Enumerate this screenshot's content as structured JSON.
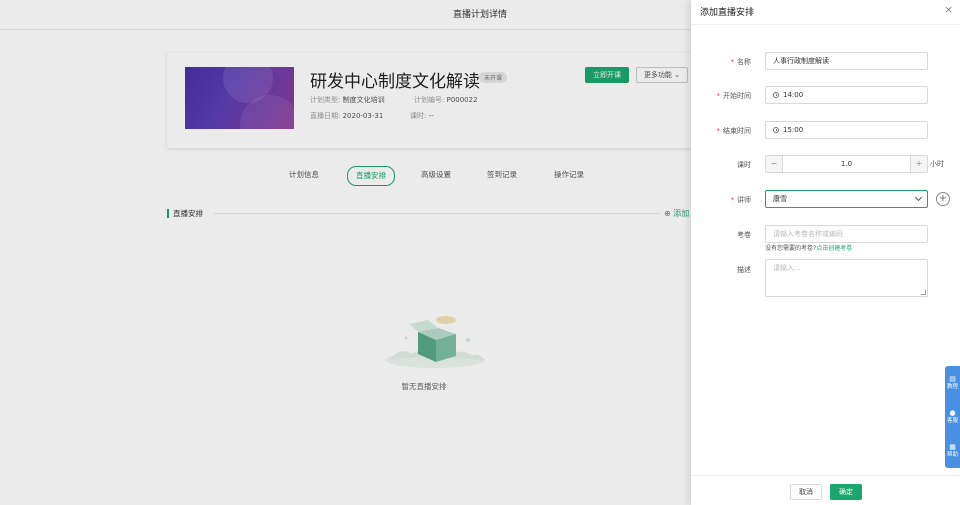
{
  "page": {
    "topbar_title": "直播计划详情"
  },
  "plan": {
    "title": "研发中心制度文化解读",
    "status": "未开课",
    "type_label": "计划类型:",
    "type_value": "制度文化培训",
    "number_label": "计划编号:",
    "number_value": "P000022",
    "date_label": "直播日期:",
    "date_value": "2020-03-31",
    "hours_label": "课时:",
    "hours_value": "--",
    "start_button": "立即开课",
    "more_button": "更多功能"
  },
  "tabs": [
    {
      "label": "计划信息"
    },
    {
      "label": "直播安排"
    },
    {
      "label": "高级设置"
    },
    {
      "label": "签到记录"
    },
    {
      "label": "操作记录"
    }
  ],
  "section": {
    "title": "直播安排",
    "add_label": "添加"
  },
  "empty": {
    "text": "暂无直播安排"
  },
  "drawer": {
    "title": "添加直播安排",
    "fields": {
      "name_label": "名称",
      "name_value": "人事行政制度解读",
      "start_label": "开始时间",
      "start_value": "14:00",
      "end_label": "结束时间",
      "end_value": "15:00",
      "hours_label": "课时",
      "hours_value": "1.0",
      "hours_unit": "小时",
      "lecturer_label": "讲师",
      "lecturer_value": "康雪",
      "exam_label": "考卷",
      "exam_placeholder": "请输入考卷名称或编码",
      "exam_hint": "没有您需要的考卷?",
      "exam_hint_link": "点击创建考卷",
      "desc_label": "描述",
      "desc_placeholder": "请输入..."
    },
    "cancel_button": "取消",
    "ok_button": "确定"
  },
  "float_bar": [
    {
      "icon": "book-icon",
      "label": "教程"
    },
    {
      "icon": "chat-icon",
      "label": "客服"
    },
    {
      "icon": "doc-icon",
      "label": "帮助"
    }
  ],
  "colors": {
    "accent": "#1ca66f",
    "required": "#e54545",
    "float_bar": "#4a90e2"
  }
}
